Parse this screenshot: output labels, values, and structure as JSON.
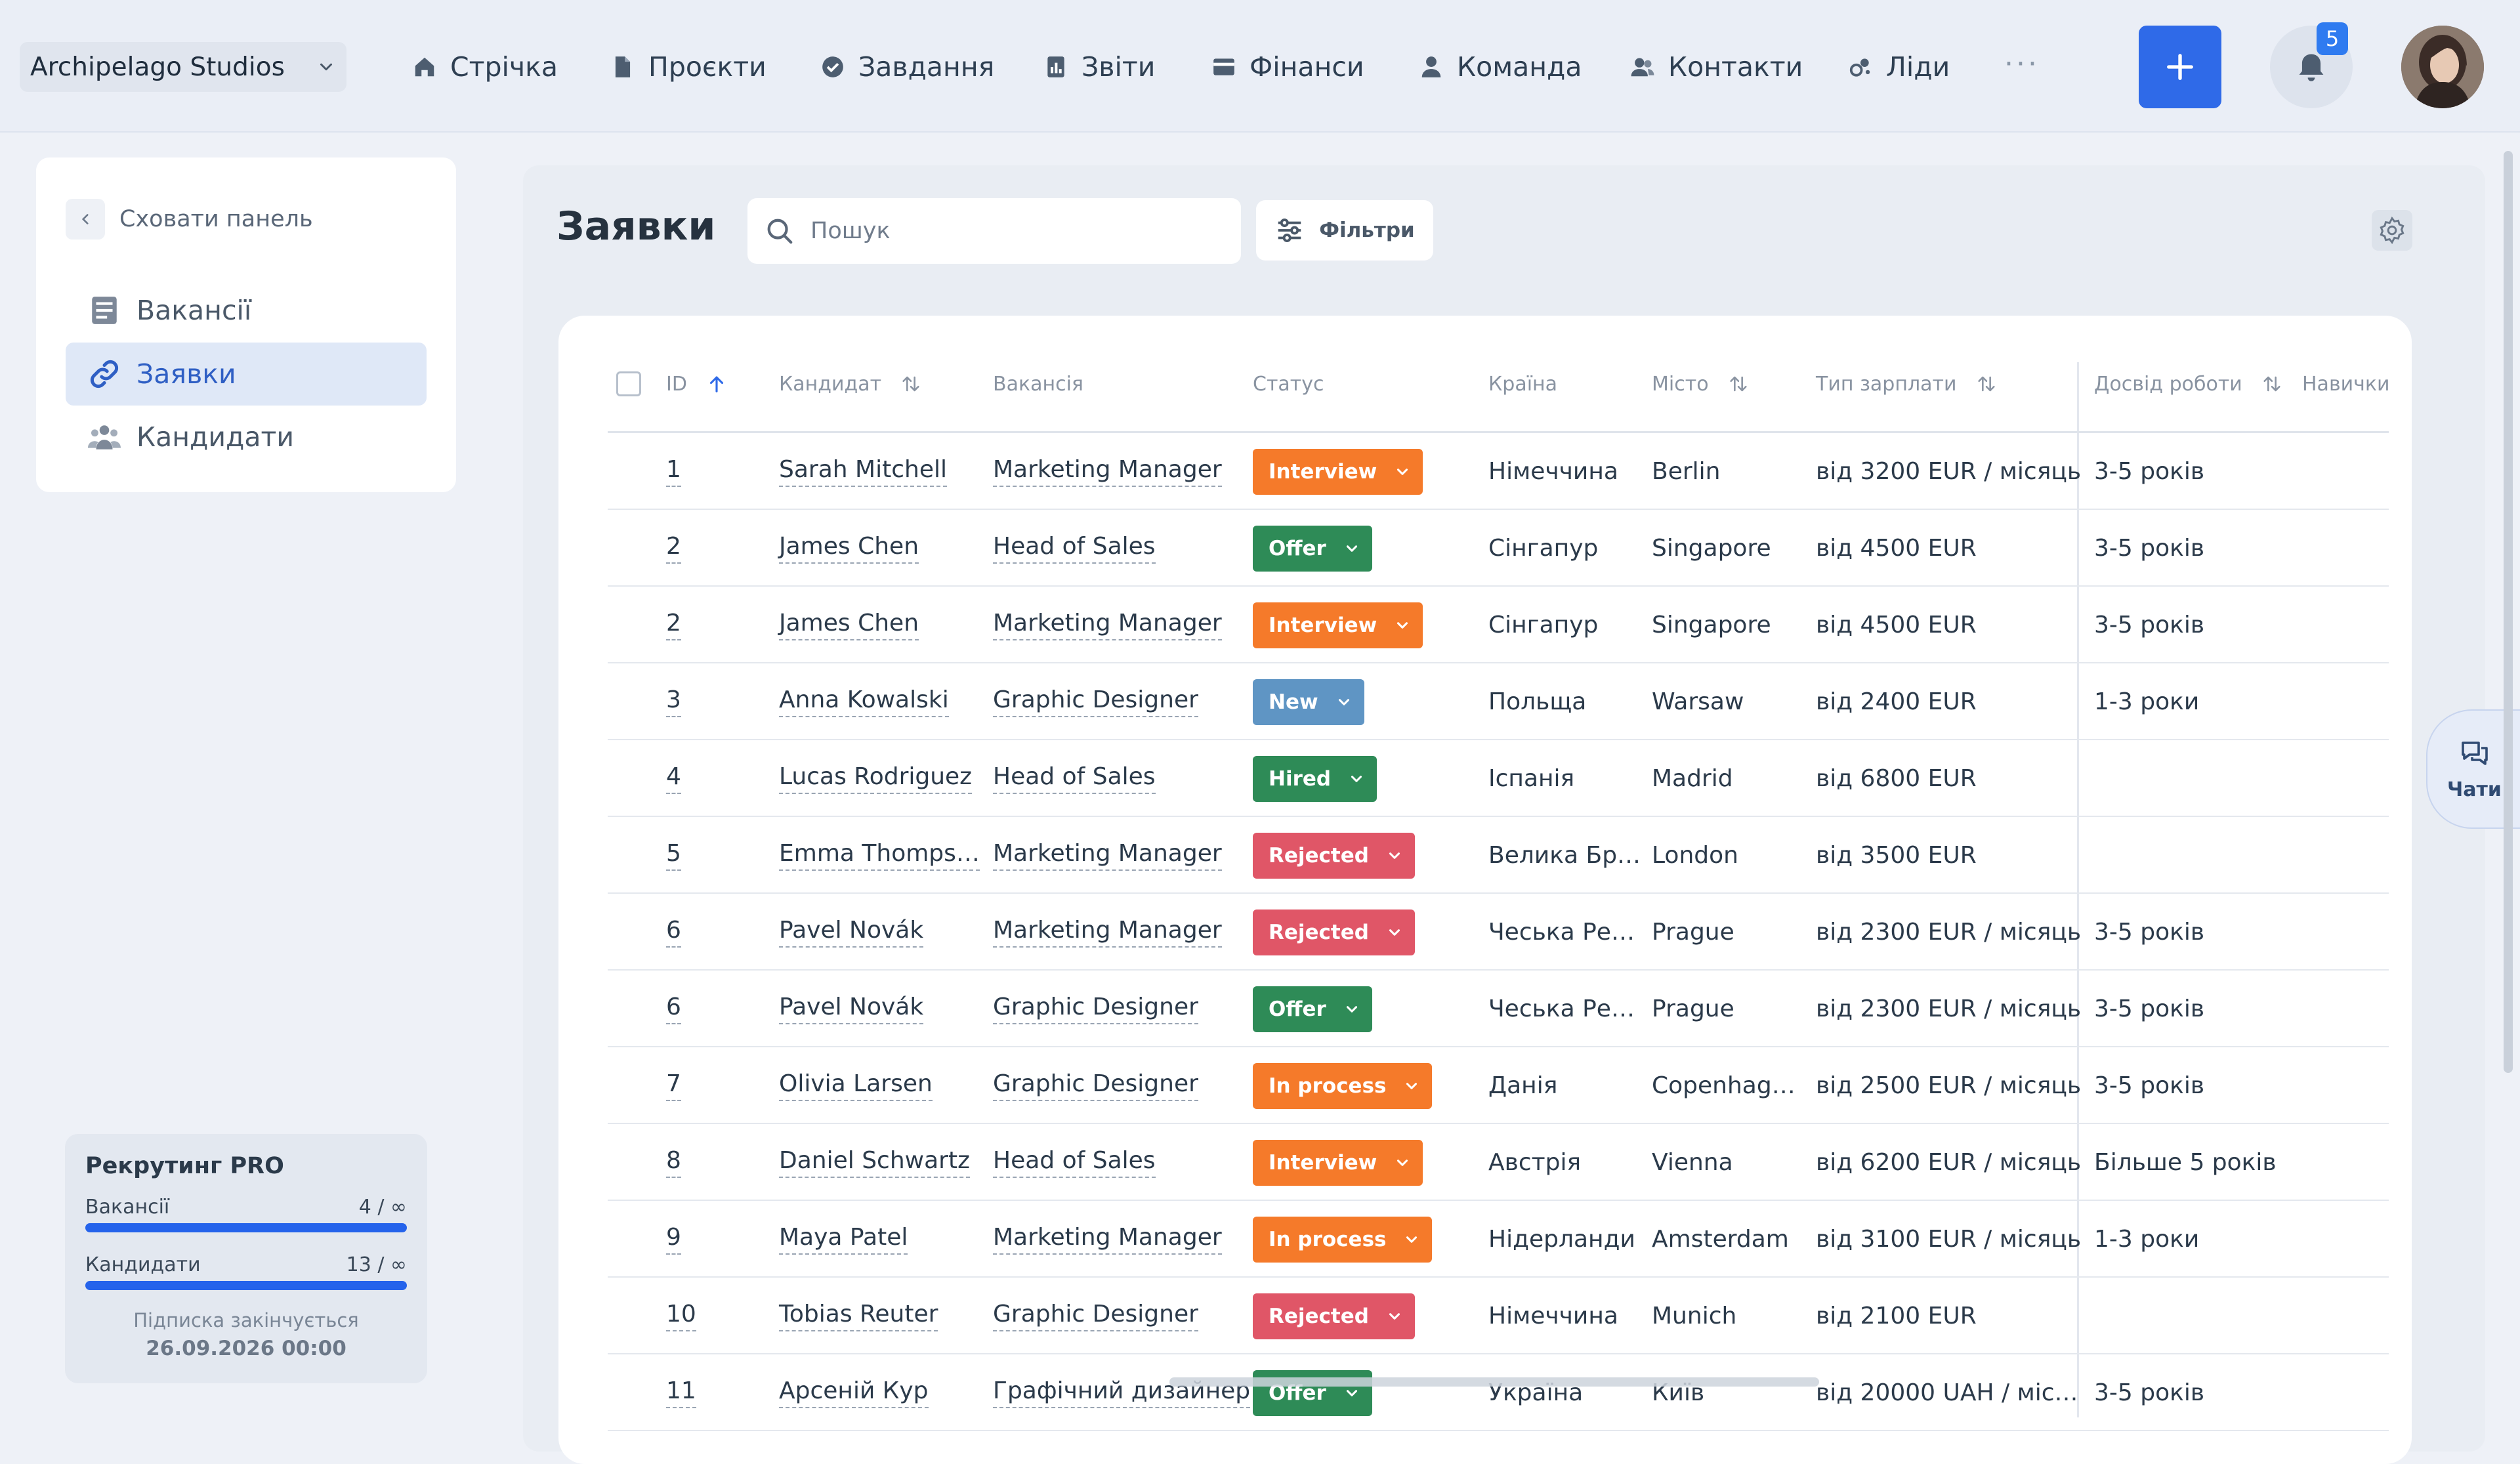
{
  "header": {
    "company": "Archipelago Studios",
    "nav": [
      {
        "label": "Стрічка",
        "icon": "home-icon"
      },
      {
        "label": "Проєкти",
        "icon": "document-icon"
      },
      {
        "label": "Завдання",
        "icon": "check-circle-icon"
      },
      {
        "label": "Звіти",
        "icon": "report-icon"
      },
      {
        "label": "Фінанси",
        "icon": "wallet-icon"
      },
      {
        "label": "Команда",
        "icon": "person-icon"
      },
      {
        "label": "Контакти",
        "icon": "contacts-icon"
      },
      {
        "label": "Ліди",
        "icon": "leads-icon"
      }
    ],
    "more": "···",
    "add_label": "+",
    "notifications_count": "5",
    "accent_color": "#2f6ae8"
  },
  "sidebar": {
    "hide_label": "Сховати панель",
    "items": [
      {
        "label": "Вакансії",
        "icon": "list-icon",
        "active": false
      },
      {
        "label": "Заявки",
        "icon": "link-icon",
        "active": true
      },
      {
        "label": "Кандидати",
        "icon": "users-icon",
        "active": false
      }
    ],
    "plan": {
      "title": "Рекрутинг PRO",
      "vacancies_label": "Вакансії",
      "vacancies_value": "4 / ∞",
      "candidates_label": "Кандидати",
      "candidates_value": "13 / ∞",
      "expires_label": "Підписка закінчується",
      "expires_date": "26.09.2026 00:00"
    }
  },
  "main": {
    "title": "Заявки",
    "search_placeholder": "Пошук",
    "filters_label": "Фільтри",
    "columns": {
      "id": "ID",
      "candidate": "Кандидат",
      "vacancy": "Вакансія",
      "status": "Статус",
      "country": "Країна",
      "city": "Місто",
      "salary": "Тип зарплати",
      "experience": "Досвід роботи",
      "skills": "Навички"
    },
    "status_colors": {
      "Interview": "#f57a2a",
      "Offer": "#2e8b57",
      "New": "#5f95c4",
      "Hired": "#2e8b57",
      "Rejected": "#e05667",
      "In process": "#f57a2a"
    },
    "rows": [
      {
        "id": "1",
        "candidate": "Sarah Mitchell",
        "vacancy": "Marketing Manager",
        "status": "Interview",
        "country": "Німеччина",
        "city": "Berlin",
        "salary": "від 3200 EUR / місяць",
        "experience": "3-5 років"
      },
      {
        "id": "2",
        "candidate": "James Chen",
        "vacancy": "Head of Sales",
        "status": "Offer",
        "country": "Сінгапур",
        "city": "Singapore",
        "salary": "від 4500 EUR",
        "experience": "3-5 років"
      },
      {
        "id": "2",
        "candidate": "James Chen",
        "vacancy": "Marketing Manager",
        "status": "Interview",
        "country": "Сінгапур",
        "city": "Singapore",
        "salary": "від 4500 EUR",
        "experience": "3-5 років"
      },
      {
        "id": "3",
        "candidate": "Anna Kowalski",
        "vacancy": "Graphic Designer",
        "status": "New",
        "country": "Польща",
        "city": "Warsaw",
        "salary": "від 2400 EUR",
        "experience": "1-3 роки"
      },
      {
        "id": "4",
        "candidate": "Lucas Rodriguez",
        "vacancy": "Head of Sales",
        "status": "Hired",
        "country": "Іспанія",
        "city": "Madrid",
        "salary": "від 6800 EUR",
        "experience": ""
      },
      {
        "id": "5",
        "candidate": "Emma Thomps…",
        "vacancy": "Marketing Manager",
        "status": "Rejected",
        "country": "Велика Бр…",
        "city": "London",
        "salary": "від 3500 EUR",
        "experience": ""
      },
      {
        "id": "6",
        "candidate": "Pavel Novák",
        "vacancy": "Marketing Manager",
        "status": "Rejected",
        "country": "Чеська Ре…",
        "city": "Prague",
        "salary": "від 2300 EUR / місяць",
        "experience": "3-5 років"
      },
      {
        "id": "6",
        "candidate": "Pavel Novák",
        "vacancy": "Graphic Designer",
        "status": "Offer",
        "country": "Чеська Ре…",
        "city": "Prague",
        "salary": "від 2300 EUR / місяць",
        "experience": "3-5 років"
      },
      {
        "id": "7",
        "candidate": "Olivia Larsen",
        "vacancy": "Graphic Designer",
        "status": "In process",
        "country": "Данія",
        "city": "Copenhag…",
        "salary": "від 2500 EUR / місяць",
        "experience": "3-5 років"
      },
      {
        "id": "8",
        "candidate": "Daniel Schwartz",
        "vacancy": "Head of Sales",
        "status": "Interview",
        "country": "Австрія",
        "city": "Vienna",
        "salary": "від 6200 EUR / місяць",
        "experience": "Більше 5 років"
      },
      {
        "id": "9",
        "candidate": "Maya Patel",
        "vacancy": "Marketing Manager",
        "status": "In process",
        "country": "Нідерланди",
        "city": "Amsterdam",
        "salary": "від 3100 EUR / місяць",
        "experience": "1-3 роки"
      },
      {
        "id": "10",
        "candidate": "Tobias Reuter",
        "vacancy": "Graphic Designer",
        "status": "Rejected",
        "country": "Німеччина",
        "city": "Munich",
        "salary": "від 2100 EUR",
        "experience": ""
      },
      {
        "id": "11",
        "candidate": "Арсеній Кур",
        "vacancy": "Графічний дизайнер",
        "status": "Offer",
        "country": "Україна",
        "city": "Київ",
        "salary": "від 20000 UAH / міс…",
        "experience": "3-5 років"
      }
    ]
  },
  "chats_label": "Чати"
}
